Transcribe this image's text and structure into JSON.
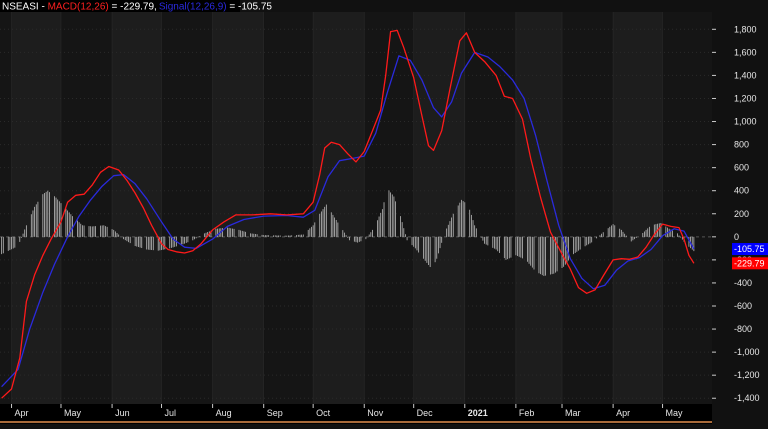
{
  "header": {
    "symbol": "NSEASI",
    "separator": " - ",
    "macd_label": "MACD(12,26)",
    "macd_eq": " = -229.79,",
    "signal_label": "Signal(12,26,9)",
    "signal_eq": " = -105.75"
  },
  "colors": {
    "background": "#111111",
    "band_light": "#1d1d1d",
    "band_dark": "#151515",
    "grid": "#2a2a2a",
    "macd": "#ff1a1a",
    "signal": "#2a2add",
    "histogram": "#bdbdbd",
    "zero_line": "#555555",
    "signal_tag": "#0000ff",
    "macd_tag": "#ff0000"
  },
  "tags": {
    "signal_value": "-105.75",
    "macd_value": "-229.79"
  },
  "chart_data": {
    "type": "line",
    "title": "",
    "y_axis_side": "right",
    "ylim": [
      -1450,
      1950
    ],
    "yticks": [
      -1400,
      -1200,
      -1000,
      -800,
      -600,
      -400,
      -200,
      0,
      200,
      400,
      600,
      800,
      1000,
      1200,
      1400,
      1600,
      1800
    ],
    "ytick_labels": [
      "-1,400",
      "-1,200",
      "-1,000",
      "-800",
      "-600",
      "-400",
      "-200",
      "0",
      "200",
      "400",
      "600",
      "800",
      "1,000",
      "1,200",
      "1,400",
      "1,600",
      "1,800"
    ],
    "x_domain": [
      "2020-03-25",
      "2021-05-31"
    ],
    "month_ticks": [
      {
        "date": "2020-04-01",
        "label": "Apr"
      },
      {
        "date": "2020-05-01",
        "label": "May"
      },
      {
        "date": "2020-06-01",
        "label": "Jun"
      },
      {
        "date": "2020-07-01",
        "label": "Jul"
      },
      {
        "date": "2020-08-01",
        "label": "Aug"
      },
      {
        "date": "2020-09-01",
        "label": "Sep"
      },
      {
        "date": "2020-10-01",
        "label": "Oct"
      },
      {
        "date": "2020-11-01",
        "label": "Nov"
      },
      {
        "date": "2020-12-01",
        "label": "Dec"
      },
      {
        "date": "2021-01-01",
        "label": "2021",
        "bold": true
      },
      {
        "date": "2021-02-01",
        "label": "Feb"
      },
      {
        "date": "2021-03-01",
        "label": "Mar"
      },
      {
        "date": "2021-04-01",
        "label": "Apr"
      },
      {
        "date": "2021-05-01",
        "label": "May"
      }
    ],
    "series": [
      {
        "name": "MACD(12,26)",
        "color": "#ff1a1a",
        "points": [
          [
            "2020-03-26",
            -1400
          ],
          [
            "2020-04-01",
            -1320
          ],
          [
            "2020-04-06",
            -1050
          ],
          [
            "2020-04-10",
            -560
          ],
          [
            "2020-04-15",
            -330
          ],
          [
            "2020-04-20",
            -160
          ],
          [
            "2020-04-25",
            -20
          ],
          [
            "2020-05-01",
            130
          ],
          [
            "2020-05-05",
            300
          ],
          [
            "2020-05-10",
            360
          ],
          [
            "2020-05-15",
            370
          ],
          [
            "2020-05-20",
            450
          ],
          [
            "2020-05-25",
            560
          ],
          [
            "2020-05-30",
            610
          ],
          [
            "2020-06-05",
            580
          ],
          [
            "2020-06-10",
            490
          ],
          [
            "2020-06-15",
            380
          ],
          [
            "2020-06-20",
            250
          ],
          [
            "2020-06-25",
            100
          ],
          [
            "2020-07-01",
            -60
          ],
          [
            "2020-07-05",
            -110
          ],
          [
            "2020-07-10",
            -130
          ],
          [
            "2020-07-15",
            -140
          ],
          [
            "2020-07-20",
            -120
          ],
          [
            "2020-07-25",
            -60
          ],
          [
            "2020-08-01",
            60
          ],
          [
            "2020-08-08",
            130
          ],
          [
            "2020-08-15",
            190
          ],
          [
            "2020-08-25",
            190
          ],
          [
            "2020-09-05",
            200
          ],
          [
            "2020-09-15",
            190
          ],
          [
            "2020-09-25",
            200
          ],
          [
            "2020-10-01",
            300
          ],
          [
            "2020-10-05",
            540
          ],
          [
            "2020-10-08",
            770
          ],
          [
            "2020-10-12",
            820
          ],
          [
            "2020-10-17",
            800
          ],
          [
            "2020-10-22",
            720
          ],
          [
            "2020-10-27",
            650
          ],
          [
            "2020-11-01",
            740
          ],
          [
            "2020-11-06",
            920
          ],
          [
            "2020-11-11",
            1100
          ],
          [
            "2020-11-14",
            1400
          ],
          [
            "2020-11-17",
            1780
          ],
          [
            "2020-11-21",
            1790
          ],
          [
            "2020-11-25",
            1640
          ],
          [
            "2020-12-01",
            1380
          ],
          [
            "2020-12-06",
            1050
          ],
          [
            "2020-12-10",
            790
          ],
          [
            "2020-12-13",
            750
          ],
          [
            "2020-12-18",
            920
          ],
          [
            "2020-12-23",
            1280
          ],
          [
            "2020-12-29",
            1700
          ],
          [
            "2021-01-02",
            1770
          ],
          [
            "2021-01-07",
            1600
          ],
          [
            "2021-01-13",
            1520
          ],
          [
            "2021-01-20",
            1400
          ],
          [
            "2021-01-25",
            1220
          ],
          [
            "2021-01-30",
            1200
          ],
          [
            "2021-02-05",
            1020
          ],
          [
            "2021-02-10",
            680
          ],
          [
            "2021-02-16",
            340
          ],
          [
            "2021-02-22",
            40
          ],
          [
            "2021-03-01",
            -150
          ],
          [
            "2021-03-06",
            -280
          ],
          [
            "2021-03-11",
            -440
          ],
          [
            "2021-03-16",
            -490
          ],
          [
            "2021-03-21",
            -460
          ],
          [
            "2021-03-26",
            -340
          ],
          [
            "2021-04-01",
            -200
          ],
          [
            "2021-04-06",
            -190
          ],
          [
            "2021-04-11",
            -195
          ],
          [
            "2021-04-16",
            -175
          ],
          [
            "2021-04-21",
            -90
          ],
          [
            "2021-04-26",
            20
          ],
          [
            "2021-05-01",
            110
          ],
          [
            "2021-05-06",
            90
          ],
          [
            "2021-05-11",
            80
          ],
          [
            "2021-05-14",
            -20
          ],
          [
            "2021-05-17",
            -160
          ],
          [
            "2021-05-20",
            -229.79
          ]
        ]
      },
      {
        "name": "Signal(12,26,9)",
        "color": "#2a2add",
        "points": [
          [
            "2020-03-26",
            -1300
          ],
          [
            "2020-04-05",
            -1150
          ],
          [
            "2020-04-12",
            -800
          ],
          [
            "2020-04-20",
            -480
          ],
          [
            "2020-04-27",
            -240
          ],
          [
            "2020-05-05",
            0
          ],
          [
            "2020-05-12",
            180
          ],
          [
            "2020-05-19",
            320
          ],
          [
            "2020-05-26",
            440
          ],
          [
            "2020-06-02",
            530
          ],
          [
            "2020-06-08",
            540
          ],
          [
            "2020-06-15",
            460
          ],
          [
            "2020-06-22",
            330
          ],
          [
            "2020-07-01",
            130
          ],
          [
            "2020-07-08",
            -20
          ],
          [
            "2020-07-15",
            -90
          ],
          [
            "2020-07-22",
            -100
          ],
          [
            "2020-08-01",
            -20
          ],
          [
            "2020-08-10",
            90
          ],
          [
            "2020-08-20",
            150
          ],
          [
            "2020-09-01",
            180
          ],
          [
            "2020-09-15",
            185
          ],
          [
            "2020-09-25",
            170
          ],
          [
            "2020-10-02",
            230
          ],
          [
            "2020-10-10",
            520
          ],
          [
            "2020-10-17",
            660
          ],
          [
            "2020-10-25",
            680
          ],
          [
            "2020-11-01",
            700
          ],
          [
            "2020-11-08",
            900
          ],
          [
            "2020-11-15",
            1250
          ],
          [
            "2020-11-22",
            1570
          ],
          [
            "2020-11-29",
            1530
          ],
          [
            "2020-12-06",
            1360
          ],
          [
            "2020-12-13",
            1120
          ],
          [
            "2020-12-18",
            1040
          ],
          [
            "2020-12-24",
            1170
          ],
          [
            "2020-12-30",
            1420
          ],
          [
            "2021-01-07",
            1600
          ],
          [
            "2021-01-15",
            1560
          ],
          [
            "2021-01-22",
            1480
          ],
          [
            "2021-01-30",
            1360
          ],
          [
            "2021-02-06",
            1200
          ],
          [
            "2021-02-13",
            880
          ],
          [
            "2021-02-20",
            480
          ],
          [
            "2021-02-27",
            100
          ],
          [
            "2021-03-06",
            -190
          ],
          [
            "2021-03-13",
            -360
          ],
          [
            "2021-03-20",
            -450
          ],
          [
            "2021-03-27",
            -420
          ],
          [
            "2021-04-03",
            -290
          ],
          [
            "2021-04-10",
            -210
          ],
          [
            "2021-04-17",
            -180
          ],
          [
            "2021-04-24",
            -110
          ],
          [
            "2021-05-01",
            10
          ],
          [
            "2021-05-08",
            70
          ],
          [
            "2021-05-14",
            50
          ],
          [
            "2021-05-20",
            -105.75
          ]
        ]
      },
      {
        "name": "Histogram",
        "color": "#bdbdbd",
        "points": [
          [
            "2020-03-26",
            -150
          ],
          [
            "2020-04-05",
            -80
          ],
          [
            "2020-04-10",
            100
          ],
          [
            "2020-04-15",
            260
          ],
          [
            "2020-04-20",
            370
          ],
          [
            "2020-04-23",
            400
          ],
          [
            "2020-04-28",
            340
          ],
          [
            "2020-05-03",
            260
          ],
          [
            "2020-05-08",
            180
          ],
          [
            "2020-05-14",
            100
          ],
          [
            "2020-05-20",
            90
          ],
          [
            "2020-05-27",
            100
          ],
          [
            "2020-06-02",
            60
          ],
          [
            "2020-06-08",
            -20
          ],
          [
            "2020-06-15",
            -80
          ],
          [
            "2020-06-22",
            -110
          ],
          [
            "2020-06-29",
            -120
          ],
          [
            "2020-07-06",
            -100
          ],
          [
            "2020-07-13",
            -70
          ],
          [
            "2020-07-20",
            -30
          ],
          [
            "2020-07-27",
            30
          ],
          [
            "2020-08-03",
            70
          ],
          [
            "2020-08-10",
            80
          ],
          [
            "2020-08-17",
            60
          ],
          [
            "2020-08-24",
            30
          ],
          [
            "2020-09-01",
            15
          ],
          [
            "2020-09-15",
            10
          ],
          [
            "2020-09-25",
            20
          ],
          [
            "2020-10-01",
            100
          ],
          [
            "2020-10-05",
            200
          ],
          [
            "2020-10-09",
            280
          ],
          [
            "2020-10-13",
            190
          ],
          [
            "2020-10-18",
            80
          ],
          [
            "2020-10-23",
            -30
          ],
          [
            "2020-10-28",
            -50
          ],
          [
            "2020-11-02",
            -20
          ],
          [
            "2020-11-07",
            80
          ],
          [
            "2020-11-12",
            240
          ],
          [
            "2020-11-15",
            420
          ],
          [
            "2020-11-19",
            350
          ],
          [
            "2020-11-23",
            180
          ],
          [
            "2020-11-27",
            -30
          ],
          [
            "2020-12-02",
            -100
          ],
          [
            "2020-12-07",
            -190
          ],
          [
            "2020-12-12",
            -280
          ],
          [
            "2020-12-15",
            -190
          ],
          [
            "2020-12-20",
            40
          ],
          [
            "2020-12-25",
            200
          ],
          [
            "2020-12-30",
            320
          ],
          [
            "2021-01-03",
            280
          ],
          [
            "2021-01-07",
            100
          ],
          [
            "2021-01-13",
            -60
          ],
          [
            "2021-01-20",
            -110
          ],
          [
            "2021-01-26",
            -200
          ],
          [
            "2021-02-01",
            -160
          ],
          [
            "2021-02-07",
            -200
          ],
          [
            "2021-02-13",
            -300
          ],
          [
            "2021-02-18",
            -340
          ],
          [
            "2021-02-24",
            -320
          ],
          [
            "2021-03-02",
            -260
          ],
          [
            "2021-03-08",
            -150
          ],
          [
            "2021-03-14",
            -90
          ],
          [
            "2021-03-20",
            -40
          ],
          [
            "2021-03-26",
            40
          ],
          [
            "2021-04-01",
            110
          ],
          [
            "2021-04-06",
            60
          ],
          [
            "2021-04-12",
            -40
          ],
          [
            "2021-04-18",
            20
          ],
          [
            "2021-04-24",
            100
          ],
          [
            "2021-04-30",
            120
          ],
          [
            "2021-05-05",
            70
          ],
          [
            "2021-05-10",
            30
          ],
          [
            "2021-05-15",
            -60
          ],
          [
            "2021-05-20",
            -124
          ]
        ]
      }
    ]
  }
}
